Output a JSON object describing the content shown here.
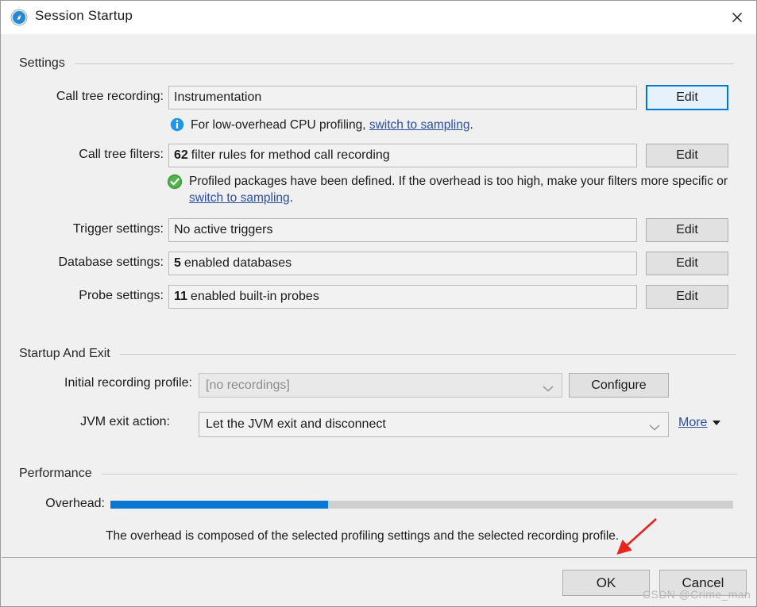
{
  "window": {
    "title": "Session Startup",
    "app_icon": "jprofiler-compass-icon",
    "close_label": "✕"
  },
  "sections": {
    "settings": {
      "title": "Settings"
    },
    "startup_and_exit": {
      "title": "Startup And Exit"
    },
    "performance": {
      "title": "Performance"
    }
  },
  "settings": {
    "call_tree_recording": {
      "label": "Call tree recording:",
      "value": "Instrumentation",
      "button": "Edit",
      "hint_prefix": "For low-overhead CPU profiling, ",
      "hint_link": "switch to sampling",
      "hint_suffix": ".",
      "hint_icon": "info-icon"
    },
    "call_tree_filters": {
      "label": "Call tree filters:",
      "value_bold": "62",
      "value": "filter rules for method call recording",
      "button": "Edit",
      "hint_prefix": "Profiled packages have been defined. If the overhead is too high, make your filters more specific or ",
      "hint_link": "switch to sampling",
      "hint_suffix": ".",
      "hint_icon": "success-check-icon"
    },
    "trigger_settings": {
      "label": "Trigger settings:",
      "value": "No active triggers",
      "button": "Edit"
    },
    "database_settings": {
      "label": "Database settings:",
      "value_bold": "5",
      "value": "enabled databases",
      "button": "Edit"
    },
    "probe_settings": {
      "label": "Probe settings:",
      "value_bold": "11",
      "value": "enabled built-in probes",
      "button": "Edit"
    }
  },
  "startup_and_exit": {
    "initial_recording_profile": {
      "label": "Initial recording profile:",
      "value": "[no recordings]",
      "button": "Configure"
    },
    "jvm_exit_action": {
      "label": "JVM exit action:",
      "value": "Let the JVM exit and disconnect",
      "more_label": "More"
    }
  },
  "performance": {
    "overhead_label": "Overhead:",
    "overhead_percent": 35,
    "description": "The overhead is composed of the selected profiling settings and the selected recording profile."
  },
  "footer": {
    "ok_label": "OK",
    "cancel_label": "Cancel"
  },
  "annotations": {
    "watermark": "CSDN @Crime_man",
    "arrow_color": "#e8251c"
  },
  "colors": {
    "accent": "#0b77d4",
    "link": "#2a4fa3",
    "focus_border": "#0078d7",
    "success": "#3fa23f",
    "panel_bg": "#f0f0f0"
  }
}
